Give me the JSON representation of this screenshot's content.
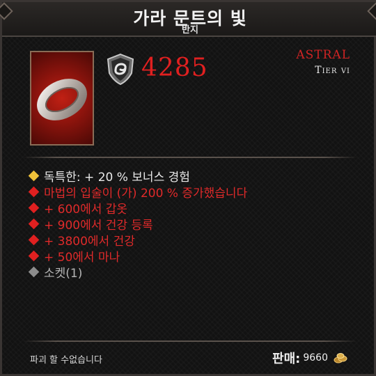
{
  "item": {
    "name": "가라 문트의 빛",
    "type": "반지",
    "armor": "4285",
    "rarity": "ASTRAL",
    "tier": "Tier vi"
  },
  "affixes": [
    {
      "text": "독특한: + 20 % 보너스 경험",
      "color": "#e9e9e9",
      "bullet_color": "#f0c23a"
    },
    {
      "text": "마법의 입술이 (가) 200 % 증가했습니다",
      "color": "#e02a2a",
      "bullet_color": "#e02020"
    },
    {
      "text": "+ 600에서 갑옷",
      "color": "#e02a2a",
      "bullet_color": "#e02020"
    },
    {
      "text": "+ 900에서 건강 등록",
      "color": "#e02a2a",
      "bullet_color": "#e02020"
    },
    {
      "text": "+ 3800에서 건강",
      "color": "#e02a2a",
      "bullet_color": "#e02020"
    },
    {
      "text": "+ 50에서 마나",
      "color": "#e02a2a",
      "bullet_color": "#e02020"
    },
    {
      "text": "소켓(1)",
      "color": "#b5b5b5",
      "bullet_color": "#8c8c8c"
    }
  ],
  "footer": {
    "note": "파괴 할 수없습니다",
    "sell_label": "판매:",
    "sell_value": "9660"
  },
  "icons": {
    "armor": "shield-swirl-icon",
    "currency": "gold-coins-icon",
    "item": "ring-icon"
  }
}
